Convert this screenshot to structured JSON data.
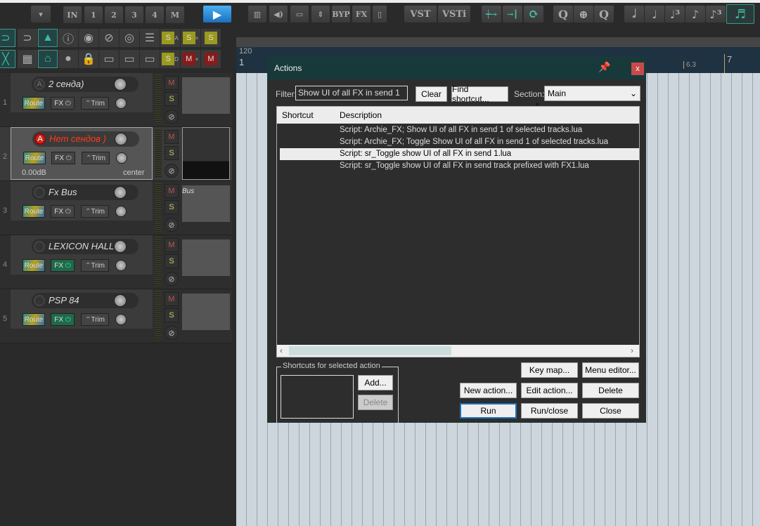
{
  "toolbar": {
    "row1": [
      "IN",
      "1",
      "2",
      "3",
      "4",
      "M"
    ],
    "fx_buttons": [
      "BYP",
      "FX",
      "VST",
      "VSTi"
    ],
    "row2_solo": [
      "S",
      "S",
      "S"
    ],
    "row3_solo": [
      "S"
    ],
    "row3_mute": [
      "M",
      "M"
    ],
    "solo_badges": [
      "A",
      "×",
      "D",
      "×"
    ]
  },
  "ruler": {
    "tempo": "120",
    "marks": [
      "1",
      "6.3",
      "7"
    ]
  },
  "tracks": [
    {
      "num": "1",
      "name": "2 сенда)",
      "rec": "A",
      "route": "Route",
      "fx": "FX",
      "trim": "Trim",
      "mute": "M",
      "solo": "S",
      "fx_active": false
    },
    {
      "num": "2",
      "name": "Нет сендов )",
      "rec": "A",
      "route": "Route",
      "fx": "FX",
      "trim": "Trim",
      "volume": "0.00dB",
      "pan": "center",
      "mute": "M",
      "solo": "S",
      "selected": true,
      "fx_active": false
    },
    {
      "num": "3",
      "name": "Fx Bus",
      "route": "Route",
      "fx": "FX",
      "trim": "Trim",
      "mute": "M",
      "solo": "S",
      "item_label": "Bus",
      "fx_active": false
    },
    {
      "num": "4",
      "name": "LEXICON HALL",
      "route": "Route",
      "fx": "FX",
      "trim": "Trim",
      "mute": "M",
      "solo": "S",
      "fx_active": true
    },
    {
      "num": "5",
      "name": "PSP 84",
      "route": "Route",
      "fx": "FX",
      "trim": "Trim",
      "mute": "M",
      "solo": "S",
      "fx_active": true
    }
  ],
  "dialog": {
    "title": "Actions",
    "filter_label": "Filter:",
    "filter_value": "Show UI of all FX in send 1",
    "clear": "Clear",
    "find_shortcut": "Find shortcut...",
    "section_label": "Section:",
    "section_value": "Main",
    "columns": [
      "Shortcut",
      "Description"
    ],
    "rows": [
      "Script: Archie_FX; Show UI of all FX in send 1 of selected tracks.lua",
      "Script: Archie_FX; Toggle Show UI of all FX in send 1 of selected tracks.lua",
      "Script: sr_Toggle show UI of all FX in send 1.lua",
      "Script: sr_Toggle show UI of all FX in send track prefixed with FX1.lua"
    ],
    "selected_row": 2,
    "shortcuts_group": "Shortcuts for selected action",
    "add": "Add...",
    "delete_shortcut": "Delete",
    "key_map": "Key map...",
    "menu_editor": "Menu editor...",
    "new_action": "New action...",
    "edit_action": "Edit action...",
    "delete": "Delete",
    "run": "Run",
    "run_close": "Run/close",
    "close": "Close"
  },
  "colors": {
    "accent": "#3fb9a2",
    "dialog_title": "#17393a",
    "close_red": "#c94a4a",
    "record": "#c82a1e"
  }
}
